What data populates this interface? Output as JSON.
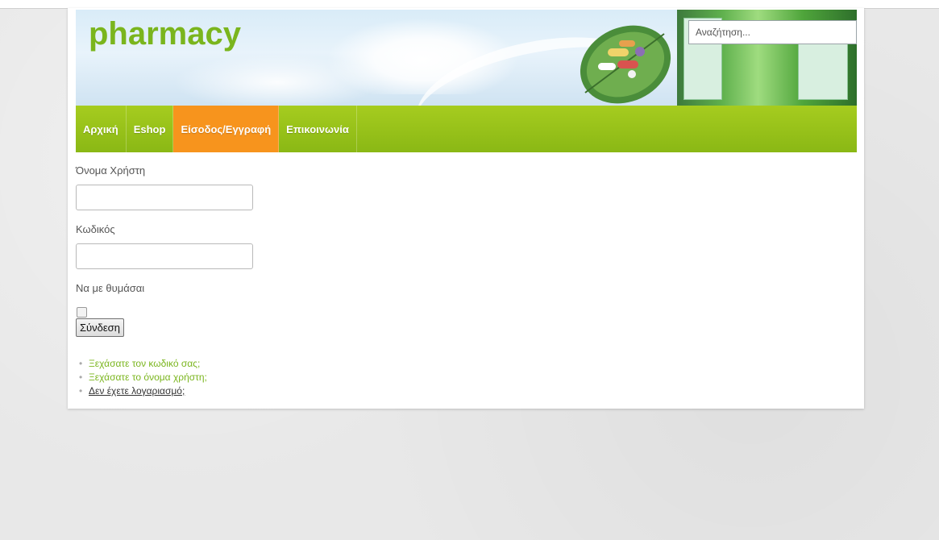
{
  "header": {
    "logo": "pharmacy",
    "search_placeholder": "Αναζήτηση..."
  },
  "nav": {
    "items": [
      {
        "label": "Αρχική",
        "active": false
      },
      {
        "label": "Eshop",
        "active": false
      },
      {
        "label": "Είσοδος/Εγγραφή",
        "active": true
      },
      {
        "label": "Επικοινωνία",
        "active": false
      }
    ]
  },
  "login_form": {
    "username_label": "Όνομα Χρήστη",
    "password_label": "Κωδικός",
    "remember_label": "Να με θυμάσαι",
    "submit_label": "Σύνδεση",
    "username_value": "",
    "password_value": ""
  },
  "links": [
    {
      "label": "Ξεχάσατε τον κωδικό σας;"
    },
    {
      "label": "Ξεχάσατε το όνομα χρήστη;"
    },
    {
      "label": "Δεν έχετε λογαριασμό;"
    }
  ],
  "colors": {
    "brand_green": "#7ab51d",
    "nav_green": "#9ac31a",
    "nav_active": "#f7941d"
  },
  "icons": [
    "leaf-pills-icon",
    "pharmacy-photo"
  ]
}
